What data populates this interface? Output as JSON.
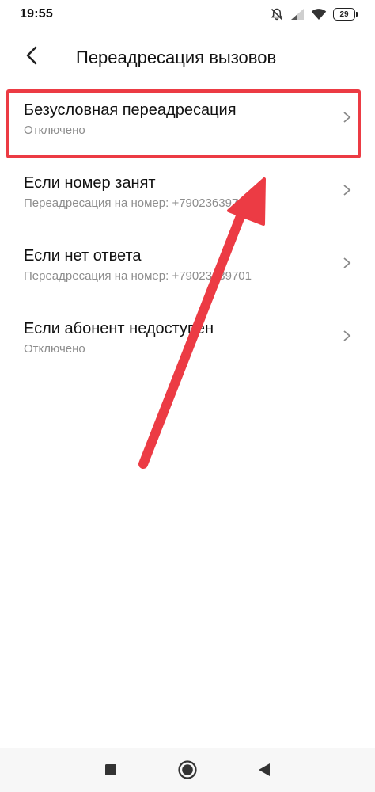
{
  "status_bar": {
    "time": "19:55",
    "icons": [
      "bell-off-icon",
      "signal-icon",
      "wifi-icon",
      "battery-icon"
    ],
    "battery_level": "29"
  },
  "header": {
    "back_icon": "chevron-left-icon",
    "title": "Переадресация вызовов"
  },
  "items": [
    {
      "title": "Безусловная переадресация",
      "subtitle": "Отключено",
      "highlighted": true
    },
    {
      "title": "Если номер занят",
      "subtitle": "Переадресация на номер: +79023639701"
    },
    {
      "title": "Если нет ответа",
      "subtitle": "Переадресация на номер: +79023639701"
    },
    {
      "title": "Если абонент недоступен",
      "subtitle": "Отключено"
    }
  ],
  "annotation": {
    "highlight_color": "#ec3b44",
    "arrow_color": "#ec3b44"
  },
  "nav_bar": {
    "icons": [
      "recents-square-icon",
      "home-circle-icon",
      "back-triangle-icon"
    ]
  }
}
